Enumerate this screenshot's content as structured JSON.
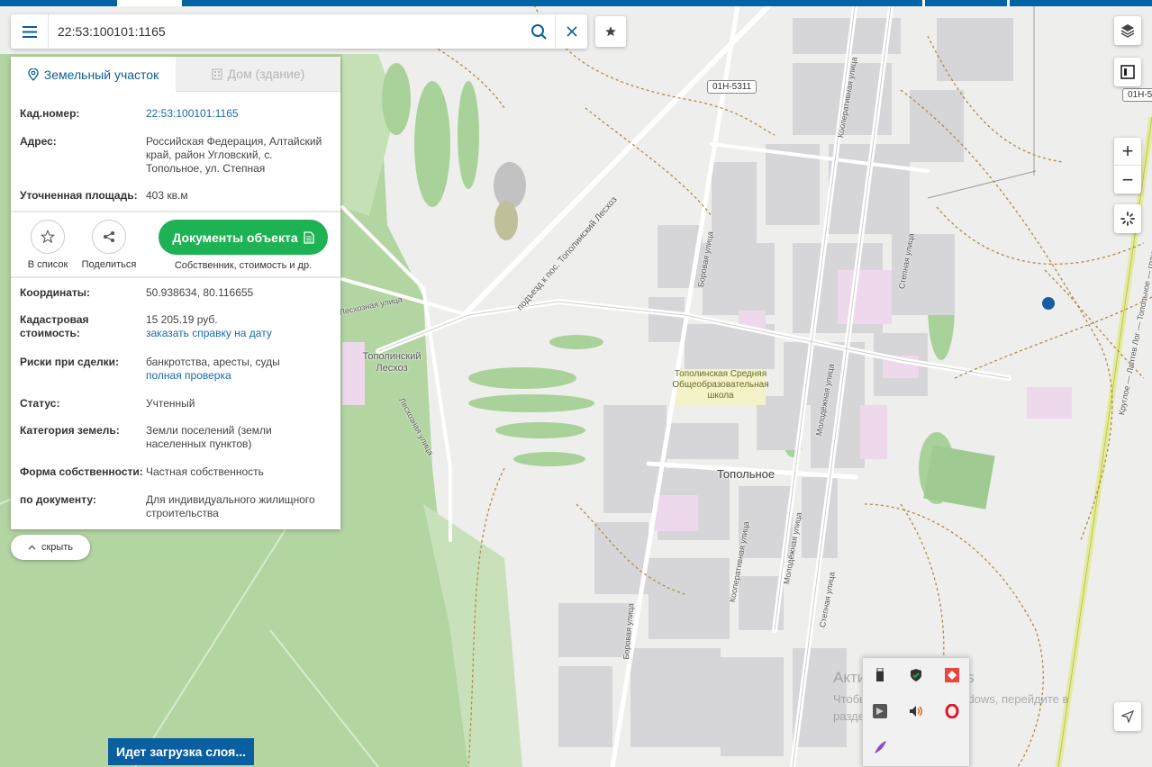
{
  "search": {
    "value": "22:53:100101:1165"
  },
  "tabs": [
    {
      "label": "Земельный участок",
      "active": true
    },
    {
      "label": "Дом (здание)",
      "active": false
    }
  ],
  "parcel": {
    "cad_label": "Кад.номер:",
    "cad_value": "22:53:100101:1165",
    "address_label": "Адрес:",
    "address_value": "Российская Федерация, Алтайский край, район Угловский, с. Топольное, ул. Степная",
    "area_label": "Уточненная площадь:",
    "area_value": "403 кв.м",
    "coords_label": "Координаты:",
    "coords_value": "50.938634, 80.116655",
    "cost_label": "Кадастровая стоимость:",
    "cost_value": "15 205.19 руб.",
    "cost_link": "заказать справку на дату",
    "risk_label": "Риски при сделки:",
    "risk_value": "банкротства, аресты, суды",
    "risk_link": "полная проверка",
    "status_label": "Статус:",
    "status_value": "Учтенный",
    "category_label": "Категория земель:",
    "category_value": "Земли поселений (земли населенных пунктов)",
    "ownership_label": "Форма собственности:",
    "ownership_value": "Частная собственность",
    "by_doc_label": "по документу:",
    "by_doc_value": "Для индивидуального жилищного строительства"
  },
  "actions": {
    "add_list": "В список",
    "share": "Поделиться",
    "docs_button": "Документы объекта",
    "docs_sub": "Собственник, стоимость и др."
  },
  "hide_label": "скрыть",
  "loading_label": "Идет загрузка слоя...",
  "map": {
    "village": "Топольное",
    "forest": "Тополинский Лесхоз",
    "school": "Тополинская Средняя Общеобразовательная школа",
    "road_shield": "01Н-5311",
    "road_shield_right": "01Н-5",
    "streets": {
      "leshoz_access": "подъезд к пос. Тополинский Лесхоз",
      "kooperativnaya": "Кооперативная улица",
      "borovaya": "Боровая улица",
      "stepnaya": "Степная улица",
      "molodezhnaya": "Молодёжная улица",
      "leskhoznaya": "Лесхозная улица",
      "leskhoznaya_top": "Лесхозная улица",
      "highway": "Круглое — Лаптев Лог — Топольное — граница с Республикой Казахстан"
    }
  },
  "watermark": {
    "title": "Активация Windows",
    "line1": "Чтобы активировать Windows, перейдите в",
    "line2": "раздел \"Параметры\"."
  },
  "colors": {
    "accent": "#0b5e94",
    "button_green": "#1db253",
    "forest": "#b2d4a0"
  }
}
